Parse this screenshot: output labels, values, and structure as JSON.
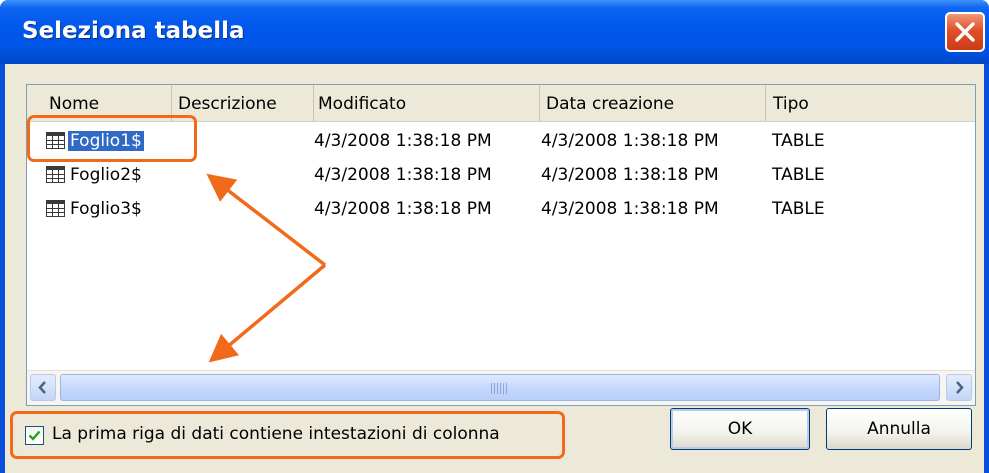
{
  "dialog": {
    "title": "Seleziona tabella",
    "close_icon": "close-icon"
  },
  "list": {
    "columns": [
      "Nome",
      "Descrizione",
      "Modificato",
      "Data creazione",
      "Tipo"
    ],
    "rows": [
      {
        "name": "Foglio1$",
        "description": "",
        "modified": "4/3/2008 1:38:18 PM",
        "created": "4/3/2008 1:38:18 PM",
        "type": "TABLE",
        "selected": true
      },
      {
        "name": "Foglio2$",
        "description": "",
        "modified": "4/3/2008 1:38:18 PM",
        "created": "4/3/2008 1:38:18 PM",
        "type": "TABLE",
        "selected": false
      },
      {
        "name": "Foglio3$",
        "description": "",
        "modified": "4/3/2008 1:38:18 PM",
        "created": "4/3/2008 1:38:18 PM",
        "type": "TABLE",
        "selected": false
      }
    ],
    "row_icon": "table-icon"
  },
  "options": {
    "header_row_label": "La prima riga di dati contiene intestazioni di colonna",
    "header_row_checked": true
  },
  "buttons": {
    "ok": "OK",
    "cancel": "Annulla"
  },
  "colors": {
    "titlebar": "#0055e5",
    "selection": "#316ac5",
    "annotation": "#f06a1a"
  }
}
